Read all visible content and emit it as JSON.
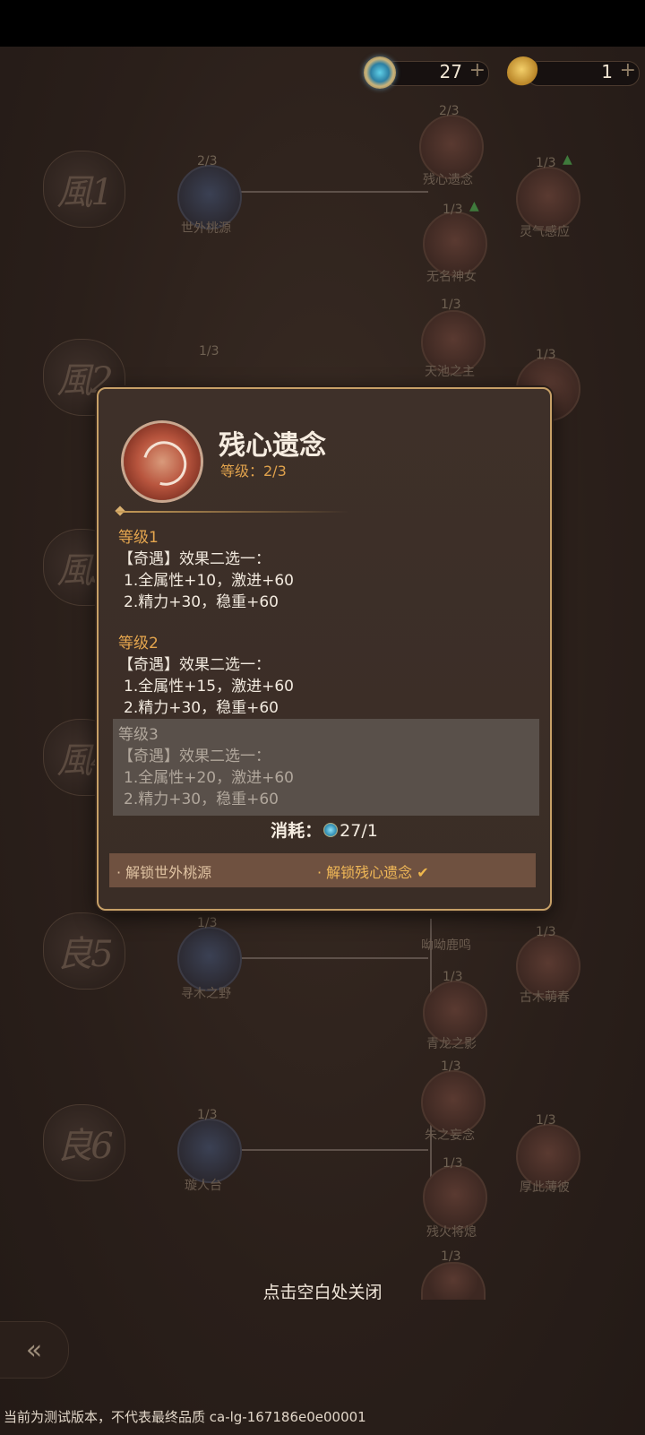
{
  "currency": [
    {
      "icon": "gem-icon",
      "value": "27",
      "plus": "+"
    },
    {
      "icon": "trophy-icon",
      "value": "1",
      "plus": "+"
    }
  ],
  "stages": [
    "風1",
    "風2",
    "風3",
    "風4",
    "良5",
    "良6"
  ],
  "tree_nodes": [
    {
      "count": "2/3",
      "name": "世外桃源"
    },
    {
      "count": "2/3",
      "name": "残心遗念"
    },
    {
      "count": "1/3",
      "name": "无名神女"
    },
    {
      "count": "1/3",
      "name": "灵气感应"
    },
    {
      "count": "1/3",
      "name": ""
    },
    {
      "count": "1/3",
      "name": "天池之主"
    },
    {
      "count": "1/3",
      "name": ""
    },
    {
      "count": "1/3",
      "name": "寻木之野"
    },
    {
      "count": "",
      "name": "呦呦鹿鸣"
    },
    {
      "count": "1/3",
      "name": "青龙之影"
    },
    {
      "count": "1/3",
      "name": "古木萌春"
    },
    {
      "count": "1/3",
      "name": "璇人台"
    },
    {
      "count": "1/3",
      "name": "朱之妄念"
    },
    {
      "count": "1/3",
      "name": "残火将熄"
    },
    {
      "count": "1/3",
      "name": "厚此薄彼"
    },
    {
      "count": "1/3",
      "name": ""
    }
  ],
  "modal": {
    "title": "残心遗念",
    "level_text": "等级：2/3",
    "levels": [
      {
        "header": "等级1",
        "line1": "【奇遇】效果二选一：",
        "line2": "1.全属性+10，激进+60",
        "line3": "2.精力+30，稳重+60"
      },
      {
        "header": "等级2",
        "line1": "【奇遇】效果二选一：",
        "line2": "1.全属性+15，激进+60",
        "line3": "2.精力+30，稳重+60"
      },
      {
        "header": "等级3",
        "line1": "【奇遇】效果二选一：",
        "line2": "1.全属性+20，激进+60",
        "line3": "2.精力+30，稳重+60"
      }
    ],
    "cost_label": "消耗：",
    "cost_value": "27/1",
    "unlock_a": "· 解锁世外桃源",
    "unlock_b": "· 解锁残心遗念",
    "check_icon": "checkmark-icon"
  },
  "close_hint": "点击空白处关闭",
  "back_icon": "back-double-chevron-icon",
  "version_text": "当前为测试版本，不代表最终品质  ca-lg-167186e0e00001"
}
